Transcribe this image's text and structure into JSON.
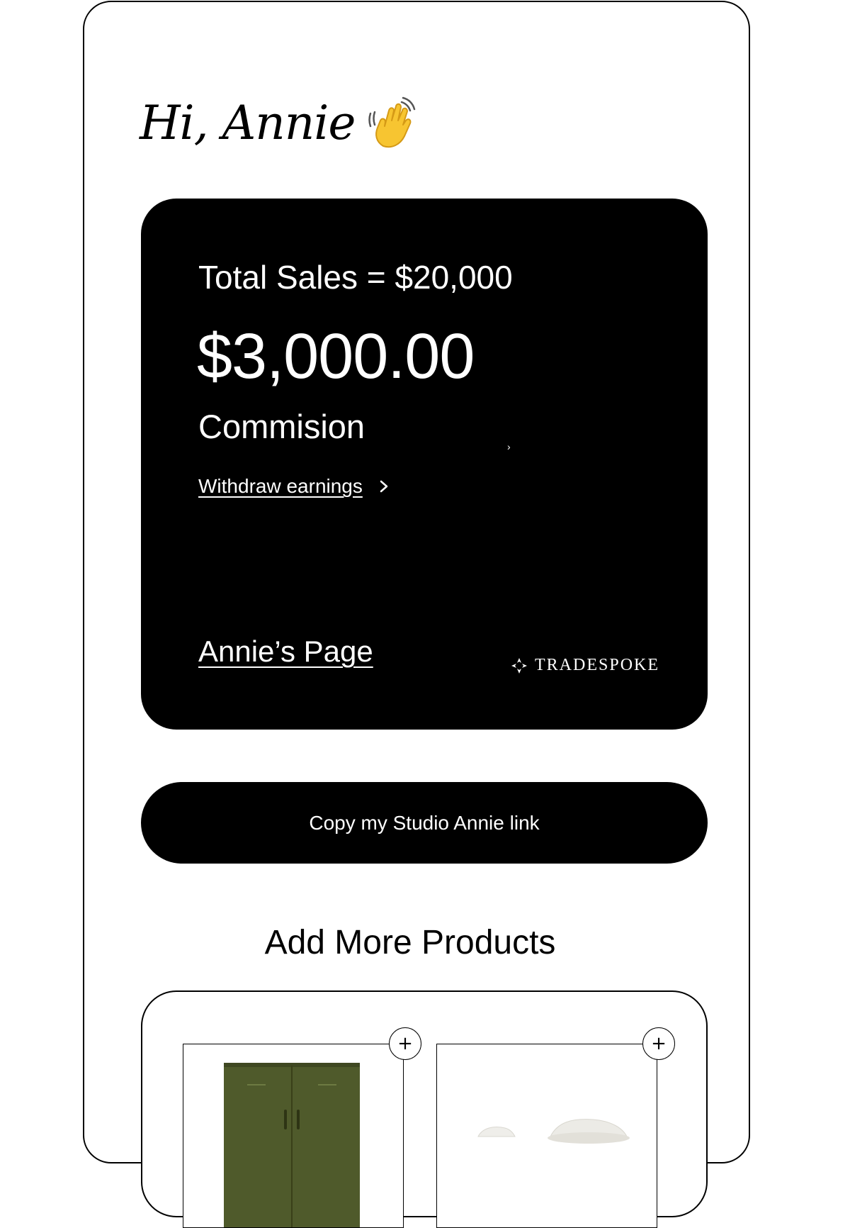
{
  "greeting": {
    "text": "Hi, Annie",
    "emoji": "👋"
  },
  "earnings_card": {
    "total_sales": "Total Sales = $20,000",
    "commission_amount": "$3,000.00",
    "commission_label": "Commision",
    "small_chevron": "›",
    "withdraw_label": "Withdraw earnings",
    "page_link": "Annie’s Page",
    "brand_name": "TRADESPOKE"
  },
  "copy_button": {
    "label": "Copy my Studio Annie link"
  },
  "products": {
    "title": "Add More Products",
    "add_label": "+",
    "items": [
      {
        "image": "olive-green-cabinet-image"
      },
      {
        "image": "white-ceramic-object-image"
      }
    ]
  },
  "colors": {
    "card_background": "#000000",
    "card_text": "#ffffff",
    "page_background": "#ffffff",
    "cabinet_green": "#4f5a2b"
  }
}
